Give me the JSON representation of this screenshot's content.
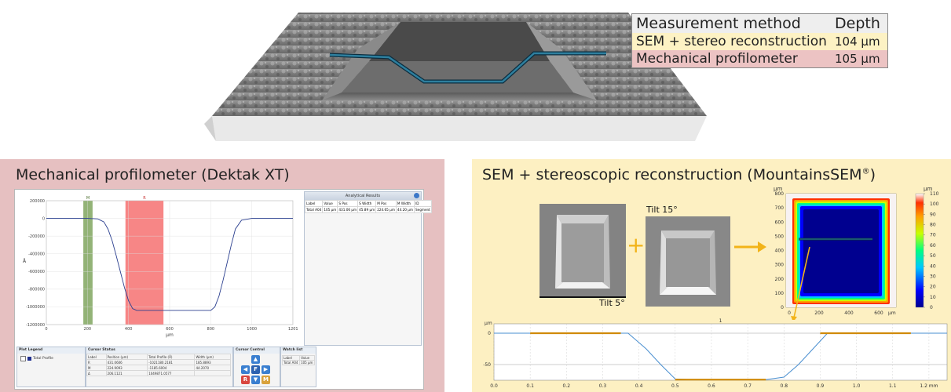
{
  "depth_table": {
    "header": {
      "method": "Measurement method",
      "depth": "Depth"
    },
    "rows": [
      {
        "method": "SEM + stereo reconstruction",
        "value": "104",
        "unit": "µm"
      },
      {
        "method": "Mechanical profilometer",
        "value": "105",
        "unit": "µm"
      }
    ]
  },
  "left_panel": {
    "title": "Mechanical profilometer (Dektak XT)",
    "analytical_results": {
      "title": "Analytical Results",
      "headers": [
        "Label",
        "Value",
        "S Pos",
        "S Width",
        "M Pos",
        "M Width",
        "ID"
      ],
      "row": [
        "Total A04",
        "105 µm",
        "431.06 µm",
        "45.89 µm",
        "224.65 µm",
        "44.20 µm",
        "Segment"
      ]
    },
    "plot_legend": {
      "title": "Plot Legend",
      "item": "Total Profile"
    },
    "cursor_status": {
      "title": "Cursor Status",
      "headers": [
        "Label",
        "Position (µm)",
        "Total Profile (Å)",
        "Width (µm)"
      ],
      "rows": [
        [
          "R",
          "431.0606",
          "-1021180.2181",
          "185.8893"
        ],
        [
          "M",
          "224.9093",
          "-1185.6004",
          "44.2070"
        ],
        [
          "Δ",
          "206.1121",
          "1049871.0577",
          ""
        ]
      ]
    },
    "cursor_control": {
      "title": "Cursor Control",
      "r": "R",
      "f": "F",
      "m": "M"
    },
    "watch_list": {
      "title": "Watch list",
      "headers": [
        "Label",
        "Value"
      ],
      "row": [
        "Total A04",
        "105 µm"
      ]
    }
  },
  "dektak_chart": {
    "type": "line",
    "ylabel": "Å",
    "xlabel": "µm",
    "xlim": [
      0,
      1200
    ],
    "ylim": [
      -1200000,
      200000
    ],
    "x_ticks": [
      "0",
      "200",
      "400",
      "600",
      "800",
      "1000",
      "1201"
    ],
    "y_ticks": [
      "200000",
      "0",
      "-200000",
      "-400000",
      "-600000",
      "-800000",
      "-1000000",
      "-1200000"
    ],
    "cursor_m": {
      "label": "M",
      "from": 180,
      "to": 225
    },
    "cursor_r": {
      "label": "R",
      "from": 385,
      "to": 570
    },
    "x": [
      0,
      100,
      200,
      250,
      280,
      300,
      320,
      340,
      360,
      380,
      400,
      420,
      440,
      500,
      600,
      700,
      800,
      820,
      840,
      860,
      880,
      900,
      920,
      950,
      1000,
      1100,
      1200
    ],
    "y": [
      0,
      0,
      0,
      -5000,
      -40000,
      -120000,
      -250000,
      -420000,
      -600000,
      -780000,
      -930000,
      -1020000,
      -1040000,
      -1040000,
      -1040000,
      -1040000,
      -1040000,
      -1000000,
      -880000,
      -700000,
      -500000,
      -300000,
      -120000,
      -20000,
      0,
      0,
      0
    ]
  },
  "right_panel": {
    "title": "SEM + stereoscopic reconstruction (MountainsSEM",
    "title_mark": "®",
    "title_end": ")",
    "tilt_15": "Tilt 15°",
    "tilt_5": "Tilt 5°",
    "plus": "+"
  },
  "heatmap_chart": {
    "type": "heatmap",
    "unit_label": "µm",
    "y_ticks": [
      "0",
      "100",
      "200",
      "300",
      "400",
      "500",
      "600",
      "700",
      "800"
    ],
    "x_ticks": [
      "0",
      "200",
      "400",
      "600"
    ],
    "x_unit": "µm",
    "colorbar_unit": "µm",
    "colorbar_ticks": [
      "0",
      "10",
      "20",
      "30",
      "40",
      "50",
      "60",
      "70",
      "80",
      "90",
      "100",
      "110"
    ],
    "colorbar_range": [
      0,
      110
    ]
  },
  "profile_chart": {
    "type": "line",
    "title": "1",
    "y_unit": "µm",
    "x_unit": "mm",
    "y_ticks": [
      "0",
      "-50"
    ],
    "x_ticks": [
      "0.0",
      "0.1",
      "0.2",
      "0.3",
      "0.4",
      "0.5",
      "0.6",
      "0.7",
      "0.8",
      "0.9",
      "1.0",
      "1.1",
      "1.2 mm"
    ],
    "xlim": [
      0,
      1.25
    ],
    "ylim": [
      -75,
      15
    ],
    "x": [
      0,
      0.1,
      0.2,
      0.3,
      0.37,
      0.42,
      0.46,
      0.5,
      0.55,
      0.6,
      0.7,
      0.75,
      0.8,
      0.84,
      0.88,
      0.92,
      1.0,
      1.1,
      1.2,
      1.25
    ],
    "y": [
      0,
      0,
      0,
      0,
      0,
      -25,
      -50,
      -73,
      -74,
      -74,
      -74,
      -74,
      -70,
      -50,
      -25,
      0,
      0,
      0,
      0,
      0
    ],
    "segments": [
      {
        "from": 0.1,
        "to": 0.35,
        "level": 0
      },
      {
        "from": 0.5,
        "to": 0.75,
        "level": -74
      },
      {
        "from": 0.9,
        "to": 1.15,
        "level": 0
      }
    ]
  },
  "colors": {
    "left_bg": "#e6c0c1",
    "right_bg": "#fdf0c2",
    "accent_orange": "#f2b318",
    "profile_line": "#1d5f77",
    "cursor_m": "#6f9a4a",
    "cursor_r": "#f45e5e"
  }
}
